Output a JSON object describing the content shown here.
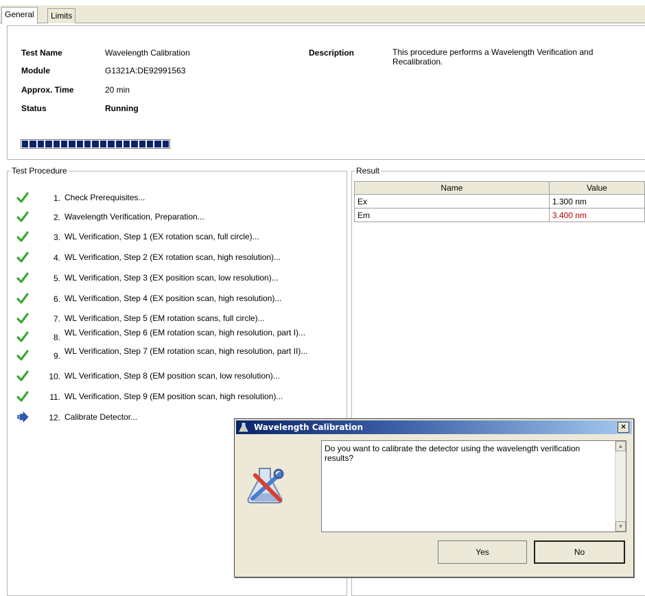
{
  "tabs": [
    {
      "label": "General",
      "active": true
    },
    {
      "label": "Limits",
      "active": false
    }
  ],
  "header": {
    "test_name_label": "Test Name",
    "test_name_value": "Wavelength Calibration",
    "module_label": "Module",
    "module_value": "G1321A:DE92991563",
    "time_label": "Approx. Time",
    "time_value": "20 min",
    "status_label": "Status",
    "status_value": "Running",
    "description_label": "Description",
    "description_value": "This procedure performs a Wavelength Verification and Recalibration.",
    "progress_segments": 19
  },
  "test_procedure": {
    "title": "Test Procedure",
    "steps": [
      {
        "num": "1.",
        "text": "Check Prerequisites...",
        "state": "done"
      },
      {
        "num": "2.",
        "text": "Wavelength Verification, Preparation...",
        "state": "done"
      },
      {
        "num": "3.",
        "text": "WL Verification, Step 1 (EX rotation scan, full circle)...",
        "state": "done"
      },
      {
        "num": "4.",
        "text": "WL Verification, Step 2 (EX rotation scan, high resolution)...",
        "state": "done"
      },
      {
        "num": "5.",
        "text": "WL Verification, Step 3 (EX position scan, low resolution)...",
        "state": "done"
      },
      {
        "num": "6.",
        "text": "WL Verification, Step 4 (EX position scan, high resolution)...",
        "state": "done"
      },
      {
        "num": "7.",
        "text": "WL Verification, Step 5 (EM rotation scans, full circle)...",
        "state": "done"
      },
      {
        "num": "8.",
        "text": "WL Verification, Step 6 (EM rotation scan, high resolution, part I)...",
        "state": "done"
      },
      {
        "num": "9.",
        "text": "WL Verification, Step 7 (EM rotation scan, high resolution, part II)...",
        "state": "done"
      },
      {
        "num": "10.",
        "text": "WL Verification, Step 8 (EM position scan, low resolution)...",
        "state": "done"
      },
      {
        "num": "11.",
        "text": "WL Verification, Step 9 (EM position scan, high resolution)...",
        "state": "done"
      },
      {
        "num": "12.",
        "text": "Calibrate Detector...",
        "state": "current"
      }
    ]
  },
  "result": {
    "title": "Result",
    "columns": [
      "Name",
      "Value"
    ],
    "rows": [
      {
        "name": "Ex",
        "value": "1.300 nm",
        "fail": false
      },
      {
        "name": "Em",
        "value": "3.400 nm",
        "fail": true
      }
    ]
  },
  "dialog": {
    "title": "Wavelength Calibration",
    "message": "Do you want to calibrate the detector using the wavelength verification results?",
    "yes_label": "Yes",
    "no_label": "No",
    "close_label": "×"
  },
  "colors": {
    "check": "#3aa832",
    "fail_value": "#b40000",
    "progress": "#0a246a",
    "titlebar_start": "#0a246a",
    "titlebar_end": "#a6caf0"
  }
}
